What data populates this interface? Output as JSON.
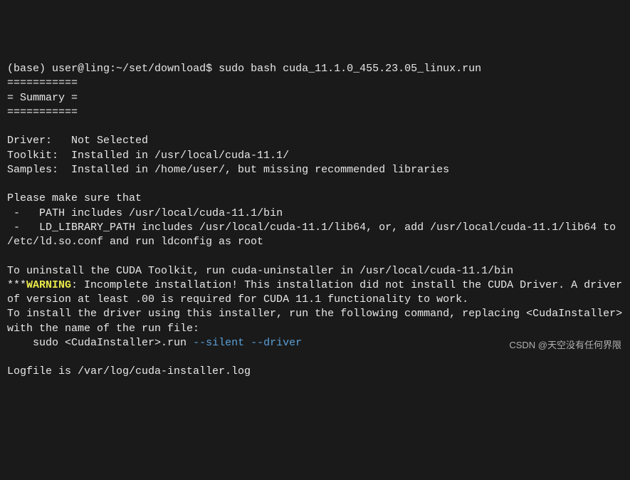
{
  "prompt": {
    "env": "(base) ",
    "userhost": "user@ling",
    "sep": ":",
    "cwd": "~/set/download",
    "sigil": "$ ",
    "cmd": "sudo bash cuda_11.1.0_455.23.05_linux.run"
  },
  "rule_top": "===========",
  "summary_label": "= Summary =",
  "rule_bot": "===========",
  "driver_line": "Driver:   Not Selected",
  "toolkit_line": "Toolkit:  Installed in /usr/local/cuda-11.1/",
  "samples_line": "Samples:  Installed in /home/user/, but missing recommended libraries",
  "ensure_heading": "Please make sure that",
  "path_bullet": " -   PATH includes /usr/local/cuda-11.1/bin",
  "ld_bullet": " -   LD_LIBRARY_PATH includes /usr/local/cuda-11.1/lib64, or, add /usr/local/cuda-11.1/lib64 to /etc/ld.so.conf and run ldconfig as root",
  "uninstall_line": "To uninstall the CUDA Toolkit, run cuda-uninstaller in /usr/local/cuda-11.1/bin",
  "warn_stars": "***",
  "warn_word": "WARNING",
  "warn_tail": ": Incomplete installation! This installation did not install the CUDA Driver. A driver of version at least .00 is required for CUDA 11.1 functionality to work.",
  "install_driver_line": "To install the driver using this installer, run the following command, replacing <CudaInstaller> with the name of the run file:",
  "install_cmd_prefix": "    sudo <CudaInstaller>.run ",
  "flag_silent": "--silent",
  "flag_sep": " ",
  "flag_driver": "--driver",
  "logfile_line": "Logfile is /var/log/cuda-installer.log",
  "watermark": "CSDN @天空没有任何界限"
}
